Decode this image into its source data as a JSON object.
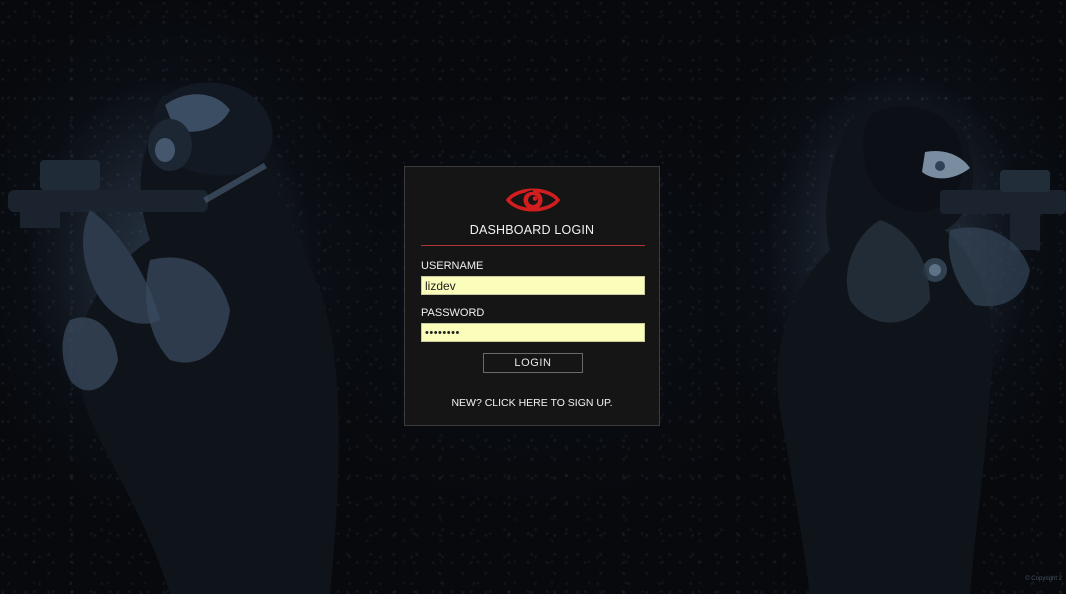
{
  "background": {
    "theme_color": "#0a0d12",
    "left_figure": "soldier-left",
    "right_figure": "soldier-right"
  },
  "login": {
    "logo_icon": "eye-icon",
    "accent_color": "#d21e1e",
    "title": "DASHBOARD LOGIN",
    "username_label": "USERNAME",
    "username_value": "lizdev",
    "password_label": "PASSWORD",
    "password_value": "••••••••",
    "login_button": "LOGIN",
    "signup_link": "NEW? CLICK HERE TO SIGN UP."
  },
  "footer": {
    "copyright": "© Copyright 2"
  }
}
